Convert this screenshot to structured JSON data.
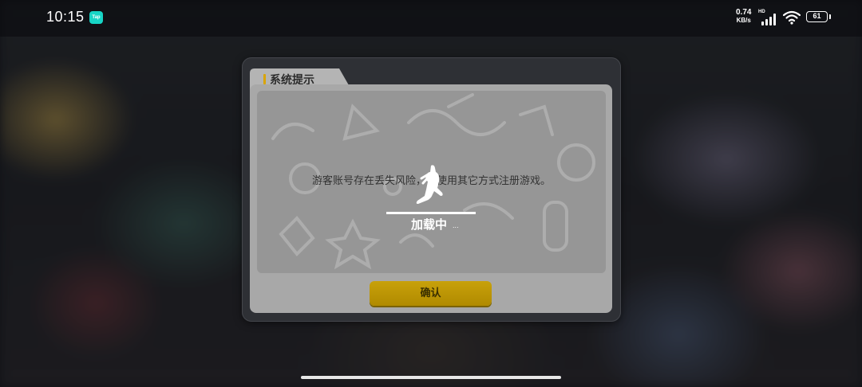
{
  "status_bar": {
    "time": "10:15",
    "app_badge": "Tap",
    "net_speed_value": "0.74",
    "net_speed_unit": "KB/s",
    "network_label": "HD",
    "battery_level": "61"
  },
  "dialog": {
    "title": "系统提示",
    "message": "游客账号存在丢失风险，请使用其它方式注册游戏。",
    "confirm_label": "确认"
  },
  "loading": {
    "text": "加载中",
    "dots": "..."
  },
  "colors": {
    "accent": "#d9a400",
    "button": "#c8a10a",
    "tap_badge": "#17d5c6"
  },
  "icons": [
    "tap-app-icon",
    "signal-icon",
    "wifi-icon",
    "battery-icon",
    "running-character-icon"
  ]
}
